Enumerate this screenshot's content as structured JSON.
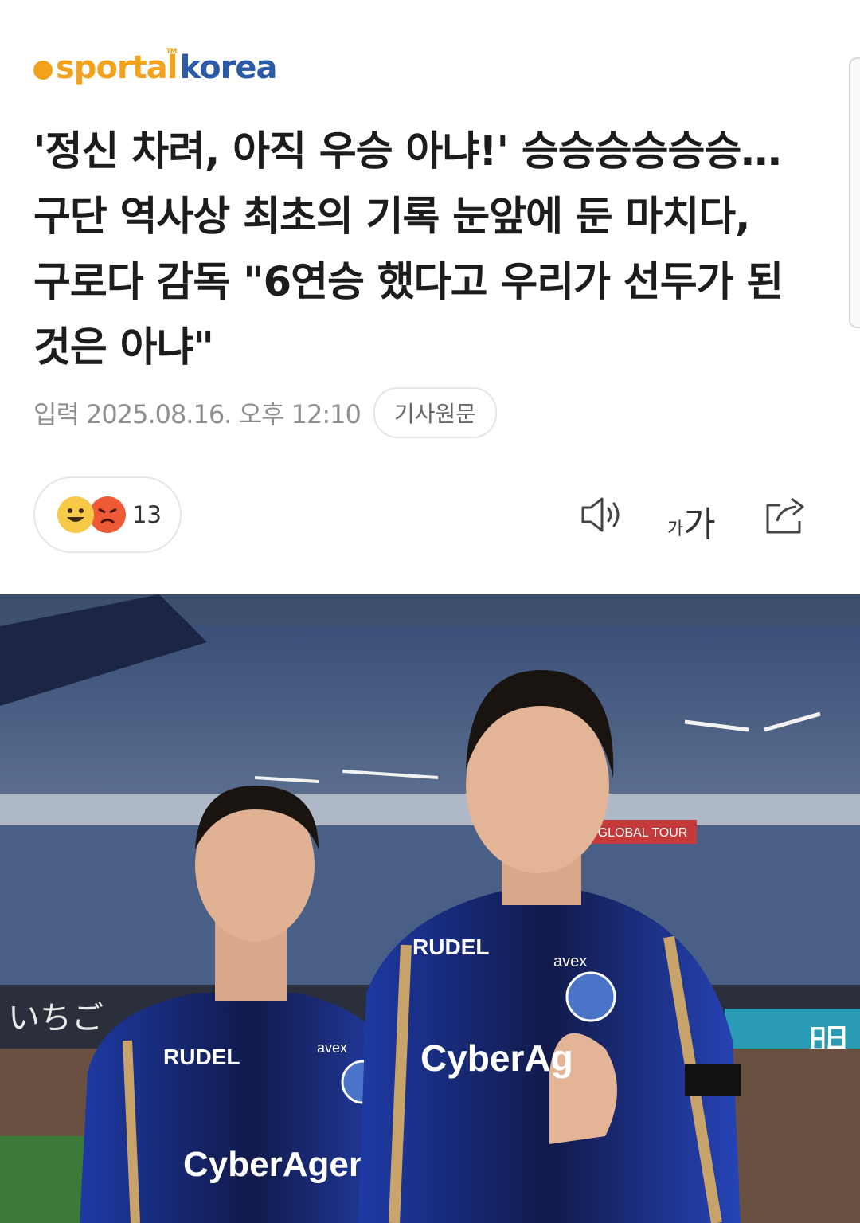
{
  "brand": {
    "logo_left": "sport",
    "logo_accent": "al",
    "logo_right": "korea",
    "logo_tm": "TM",
    "colors": {
      "orange": "#f4a11c",
      "blue": "#2b5aa8"
    }
  },
  "article": {
    "headline": "'정신 차려, 아직 우승 아냐!' 승승승승승승…구단 역사상 최초의 기록 눈앞에 둔 마치다, 구로다 감독 \"6연승 했다고 우리가 선두가 된 것은 아냐\"",
    "published_label": "입력 2025.08.16. 오후 12:10",
    "original_button": "기사원문"
  },
  "reactions": {
    "emoji": [
      "happy-emoji",
      "angry-emoji"
    ],
    "count": "13"
  },
  "toolbar": {
    "tts_icon": "speaker-icon",
    "font_small": "가",
    "font_large": "가",
    "share_icon": "share-icon"
  },
  "photo": {
    "description_icon": "photo",
    "sign_left": "いちご",
    "sign_right": "明",
    "sponsor_board": "GLOBAL TOUR",
    "jersey_left_top": "RUDEL",
    "jersey_left_bottom": "CyberAgent",
    "jersey_right_top": "RUDEL",
    "jersey_right_bottom": "CyberAg",
    "jersey_brand": "avex"
  }
}
